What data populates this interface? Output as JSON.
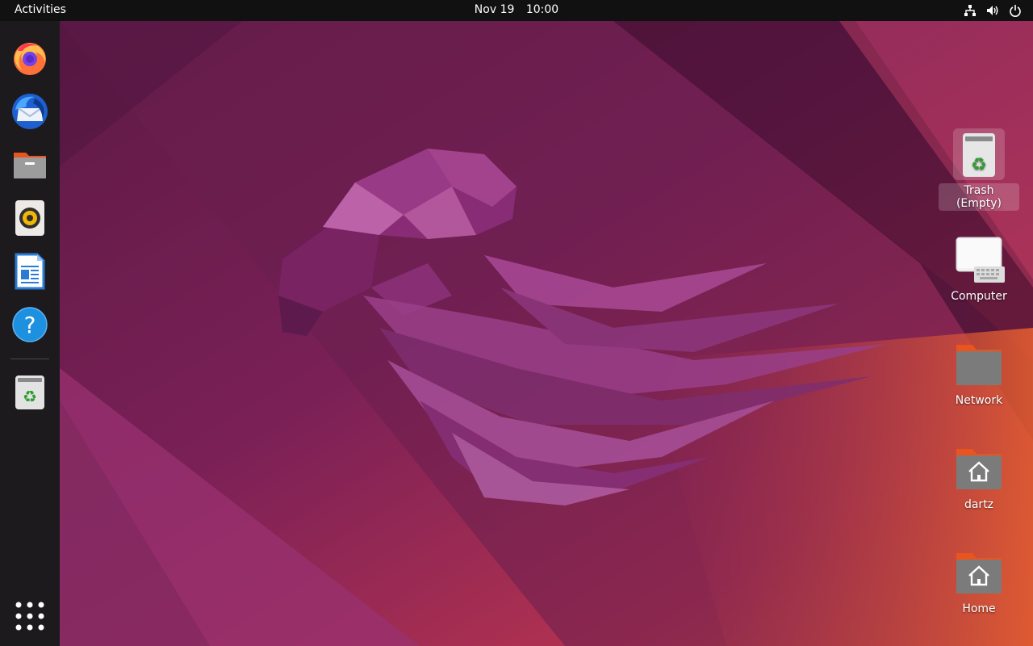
{
  "topbar": {
    "activities": "Activities",
    "date": "Nov 19",
    "time": "10:00",
    "tray_icons": [
      "network-icon",
      "volume-icon",
      "power-icon"
    ]
  },
  "dock": {
    "apps": [
      {
        "name": "Firefox",
        "icon": "firefox-icon"
      },
      {
        "name": "Thunderbird",
        "icon": "thunderbird-icon"
      },
      {
        "name": "Files",
        "icon": "files-icon"
      },
      {
        "name": "Rhythmbox",
        "icon": "rhythmbox-icon"
      },
      {
        "name": "LibreOffice Writer",
        "icon": "writer-icon"
      },
      {
        "name": "Help",
        "icon": "help-icon"
      },
      {
        "name": "Trash",
        "icon": "trash-icon"
      }
    ],
    "show_apps_icon": "app-grid-icon"
  },
  "desktop": {
    "icons": [
      {
        "label": "Trash (Empty)",
        "icon": "trash-icon",
        "selected": true
      },
      {
        "label": "Computer",
        "icon": "computer-icon"
      },
      {
        "label": "Network",
        "icon": "network-folder-icon"
      },
      {
        "label": "dartz",
        "icon": "home-folder-icon"
      },
      {
        "label": "Home",
        "icon": "home-folder-icon"
      }
    ]
  },
  "colors": {
    "topbar": "#111111",
    "dock": "#1d1a1e",
    "wallpaper_dark": "#5a1a45",
    "wallpaper_mid": "#8a2a6a",
    "wallpaper_orange": "#d8503a",
    "accent_folder": "#e9541f"
  }
}
